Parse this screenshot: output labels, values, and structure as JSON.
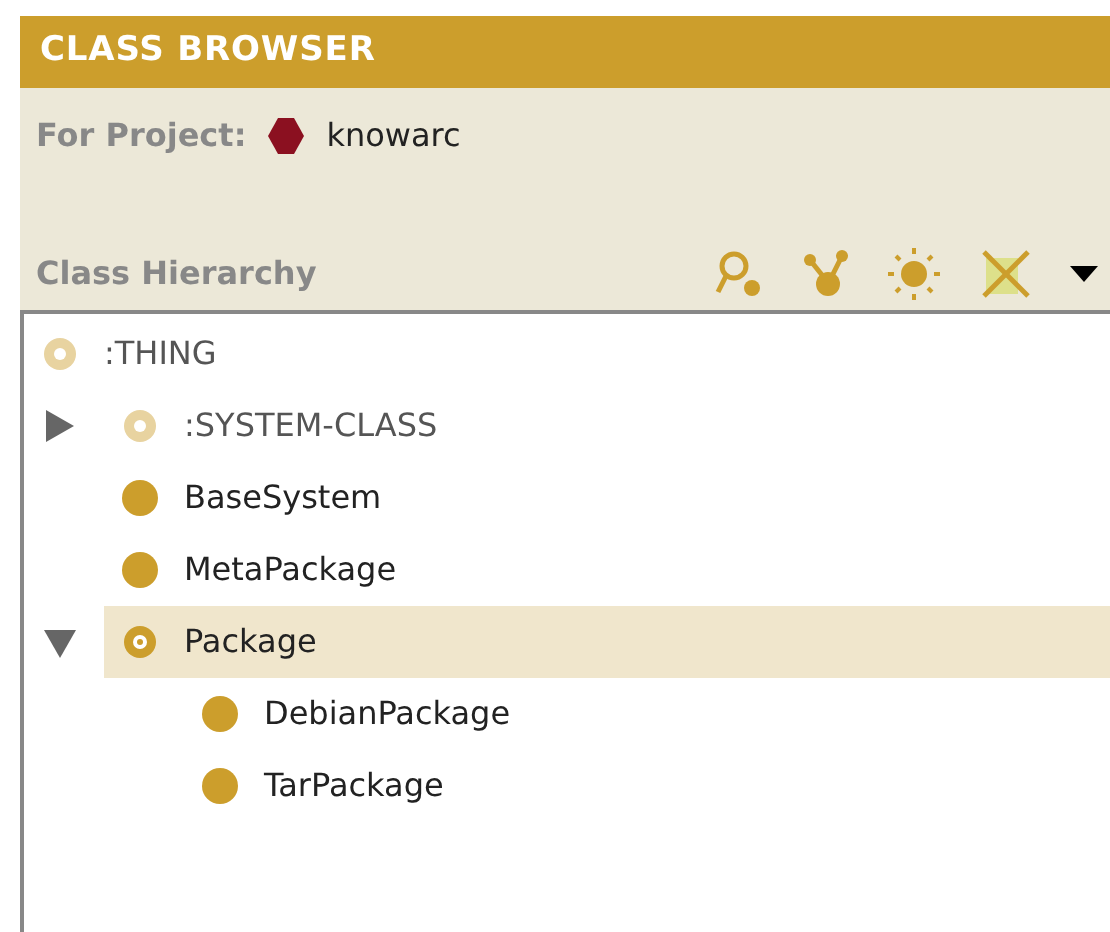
{
  "panel": {
    "title": "CLASS BROWSER",
    "project_label": "For Project:",
    "project_name": "knowarc",
    "hierarchy_label": "Class Hierarchy"
  },
  "tree": [
    {
      "label": ":THING",
      "kind": "system",
      "selected": false,
      "children": [
        {
          "label": ":SYSTEM-CLASS",
          "kind": "system",
          "selected": false,
          "expanded": false
        },
        {
          "label": "BaseSystem",
          "kind": "concrete",
          "selected": false
        },
        {
          "label": "MetaPackage",
          "kind": "concrete",
          "selected": false
        },
        {
          "label": "Package",
          "kind": "abstract",
          "selected": true,
          "expanded": true,
          "children": [
            {
              "label": "DebianPackage",
              "kind": "concrete",
              "selected": false
            },
            {
              "label": "TarPackage",
              "kind": "concrete",
              "selected": false
            }
          ]
        }
      ]
    }
  ]
}
